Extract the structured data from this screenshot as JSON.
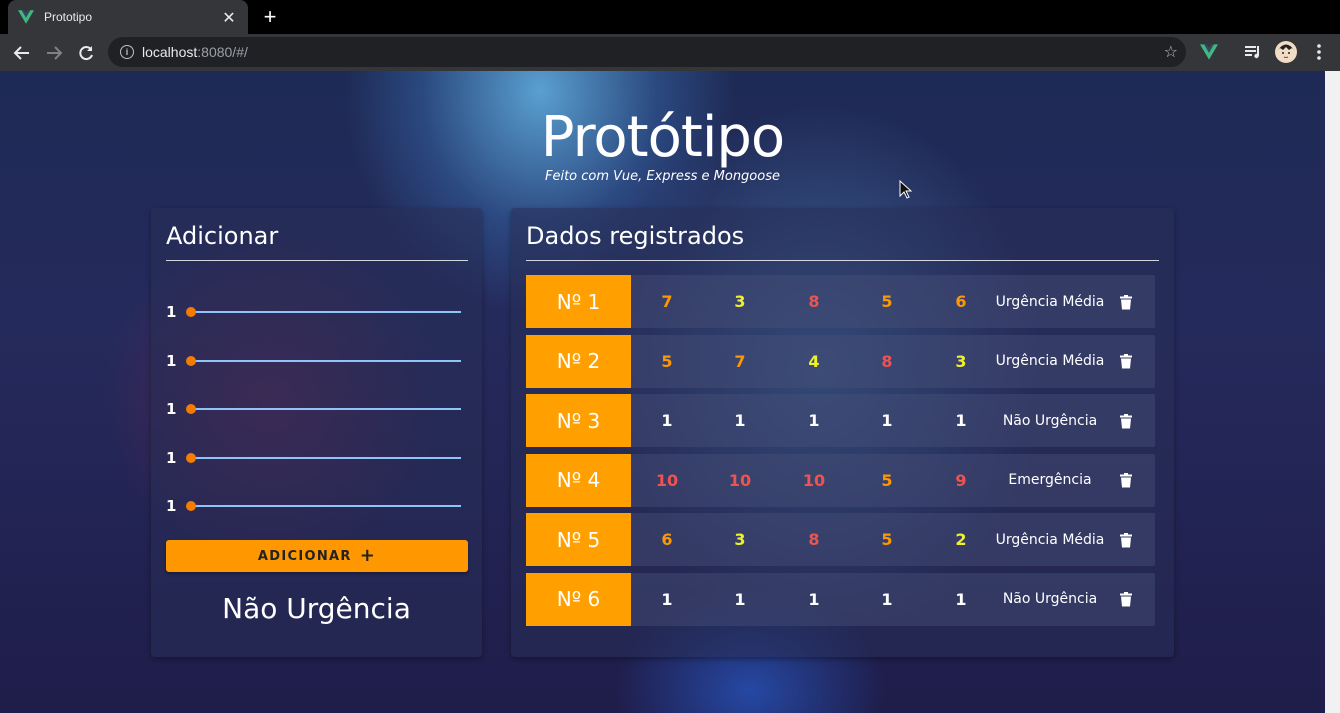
{
  "browser": {
    "tab_title": "Prototipo",
    "tab_close": "✕",
    "new_tab": "+",
    "url_host": "localhost",
    "url_rest": ":8080/#/"
  },
  "page": {
    "title": "Protótipo",
    "subtitle": "Feito com Vue, Express e Mongoose"
  },
  "add_panel": {
    "title": "Adicionar",
    "sliders": [
      1,
      1,
      1,
      1,
      1
    ],
    "slider_min": 1,
    "slider_max": 10,
    "button_label": "ADICIONAR",
    "button_icon": "+",
    "result": "Não Urgência"
  },
  "data_panel": {
    "title": "Dados registrados",
    "rows": [
      {
        "id": "Nº 1",
        "values": [
          7,
          3,
          8,
          5,
          6
        ],
        "status": "Urgência Média"
      },
      {
        "id": "Nº 2",
        "values": [
          5,
          7,
          4,
          8,
          3
        ],
        "status": "Urgência Média"
      },
      {
        "id": "Nº 3",
        "values": [
          1,
          1,
          1,
          1,
          1
        ],
        "status": "Não Urgência"
      },
      {
        "id": "Nº 4",
        "values": [
          10,
          10,
          10,
          5,
          9
        ],
        "status": "Emergência"
      },
      {
        "id": "Nº 5",
        "values": [
          6,
          3,
          8,
          5,
          2
        ],
        "status": "Urgência Média"
      },
      {
        "id": "Nº 6",
        "values": [
          1,
          1,
          1,
          1,
          1
        ],
        "status": "Não Urgência"
      }
    ]
  },
  "colors": {
    "accent": "#ffa000",
    "button": "#ff9800",
    "slider_track": "#90c4f9",
    "slider_thumb": "#f57c00",
    "value_white": "#ffffff",
    "value_yellow": "#f0f02a",
    "value_orange": "#ff9800",
    "value_red": "#ef5350"
  }
}
